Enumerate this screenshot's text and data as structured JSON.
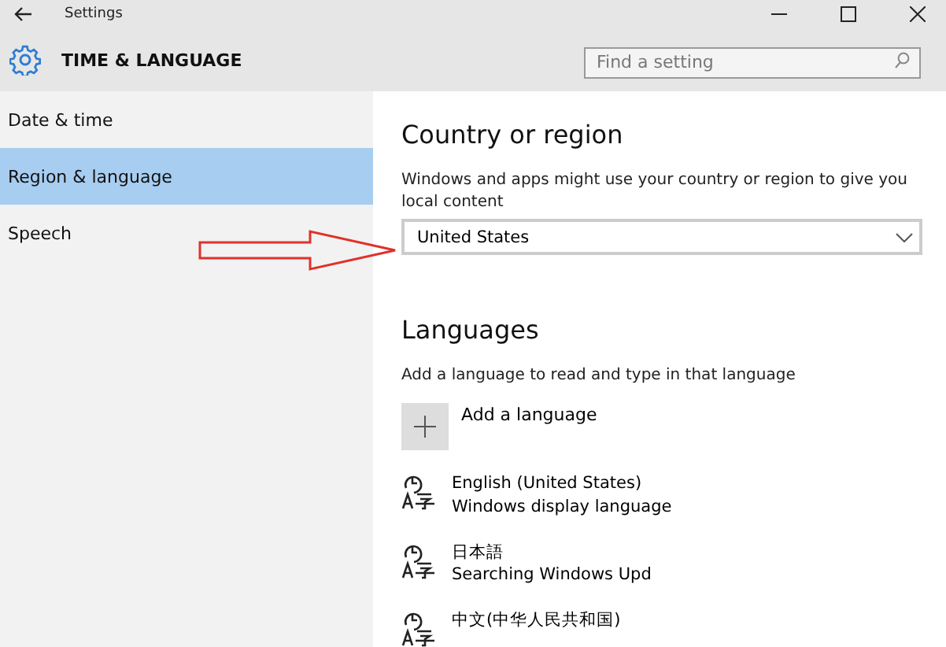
{
  "window": {
    "title": "Settings"
  },
  "header": {
    "title": "TIME & LANGUAGE",
    "search": {
      "placeholder": "Find a setting"
    }
  },
  "sidebar": {
    "items": [
      {
        "label": "Date & time",
        "selected": false
      },
      {
        "label": "Region & language",
        "selected": true
      },
      {
        "label": "Speech",
        "selected": false
      }
    ]
  },
  "country_section": {
    "heading": "Country or region",
    "description": "Windows and apps might use your country or region to give you local content",
    "dropdown": {
      "value": "United States"
    }
  },
  "languages_section": {
    "heading": "Languages",
    "description": "Add a language to read and type in that language",
    "add_button": "Add a language",
    "languages": [
      {
        "name": "English (United States)",
        "status": "Windows display language"
      },
      {
        "name": "日本語",
        "status": "Searching Windows Upd"
      },
      {
        "name": "中文(中华人民共和国)"
      }
    ]
  }
}
